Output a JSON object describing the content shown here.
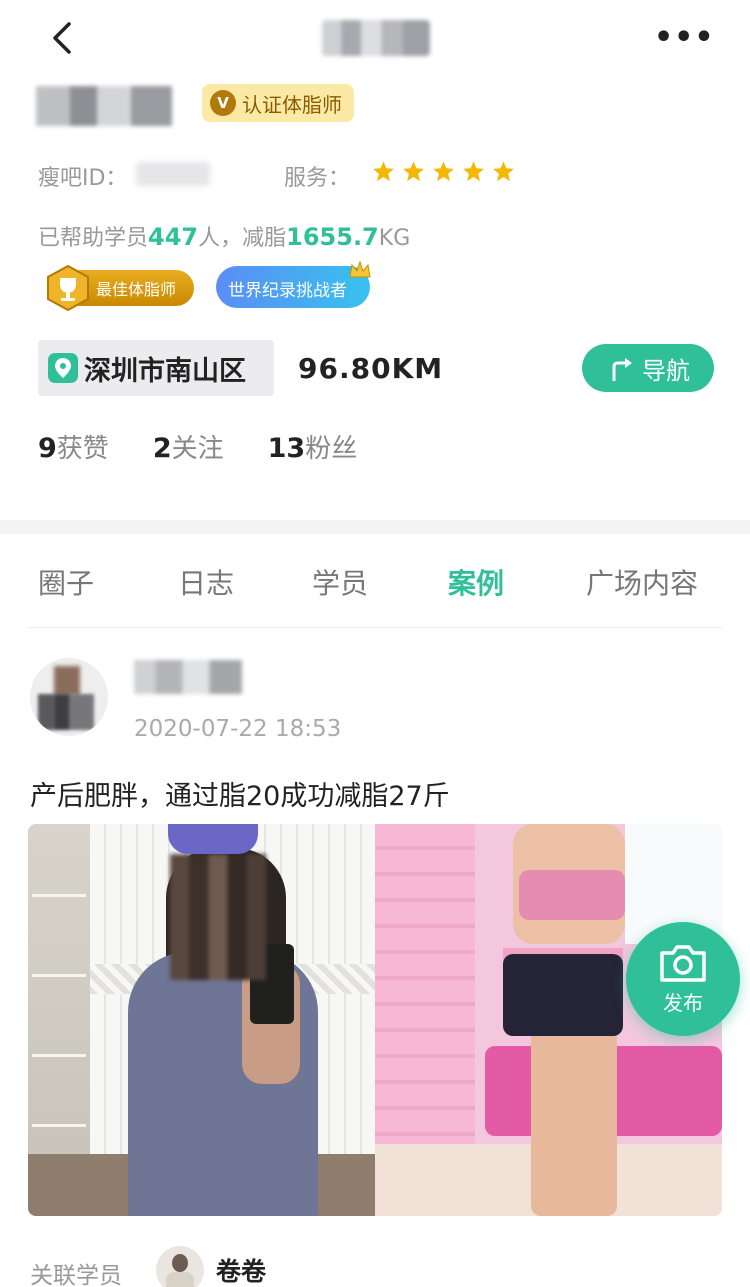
{
  "header": {
    "back_icon": "chevron-left-icon",
    "more_label": "•••"
  },
  "profile": {
    "cert_badge_icon": "V",
    "cert_badge_label": "认证体脂师",
    "id_label": "瘦吧ID：",
    "service_label": "服务：",
    "service_rating": 5,
    "help_prefix": "已帮助学员",
    "help_count": "447",
    "help_mid": "人，减脂",
    "fat_loss": "1655.7",
    "fat_unit": "KG",
    "honors": [
      {
        "label": "最佳体脂师",
        "icon": "trophy-icon",
        "color": "#d99a0a"
      },
      {
        "label": "世界纪录挑战者",
        "icon": "crown-icon",
        "color": "#4a9cf2"
      }
    ],
    "location": "深圳市南山区",
    "distance": "96.80KM",
    "nav_label": "导航",
    "stats": [
      {
        "value": "9",
        "label": "获赞"
      },
      {
        "value": "2",
        "label": "关注"
      },
      {
        "value": "13",
        "label": "粉丝"
      }
    ]
  },
  "tabs": [
    {
      "label": "圈子",
      "active": false
    },
    {
      "label": "日志",
      "active": false
    },
    {
      "label": "学员",
      "active": false
    },
    {
      "label": "案例",
      "active": true
    },
    {
      "label": "广场内容",
      "active": false
    }
  ],
  "post": {
    "time": "2020-07-22 18:53",
    "text": "产后肥胖，通过脂20成功减脂27斤",
    "related_label": "关联学员",
    "related_name": "卷卷"
  },
  "fab": {
    "icon": "camera-icon",
    "label": "发布"
  },
  "colors": {
    "accent": "#2fc09a",
    "gold": "#fde9a6",
    "star": "#f5b800"
  }
}
